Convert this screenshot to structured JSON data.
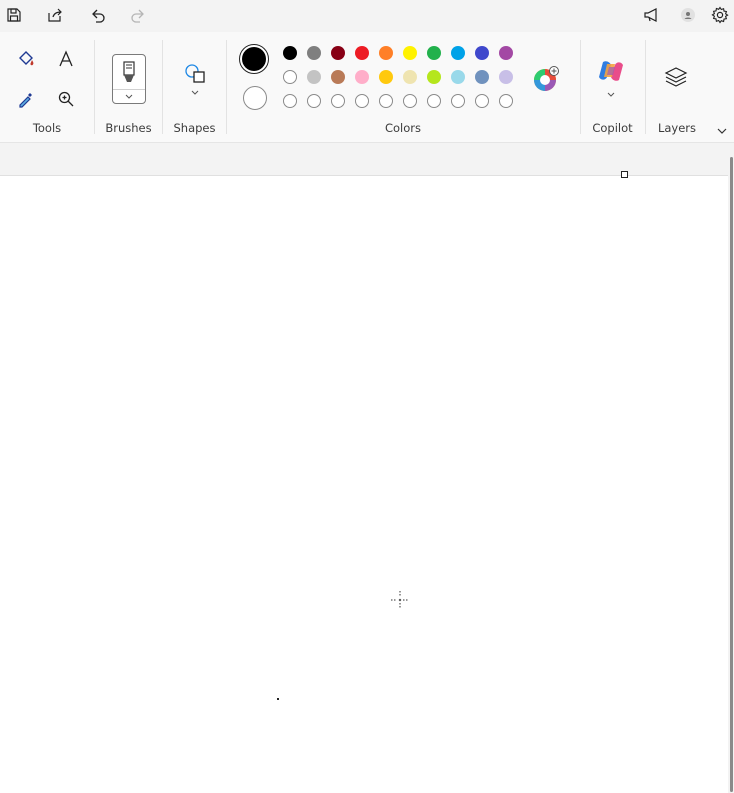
{
  "topbar": {
    "save": "save-icon",
    "share": "share-icon",
    "undo": "undo-icon",
    "redo": "redo-icon",
    "announce": "megaphone-icon",
    "account": "account-icon",
    "settings": "gear-icon"
  },
  "ribbon": {
    "tools_label": "Tools",
    "brushes_label": "Brushes",
    "shapes_label": "Shapes",
    "colors_label": "Colors",
    "copilot_label": "Copilot",
    "layers_label": "Layers",
    "primary_color": "#000000",
    "secondary_color": "#ffffff",
    "palette_row1": [
      "#000000",
      "#7f7f7f",
      "#880015",
      "#ed1c24",
      "#ff7f27",
      "#fff200",
      "#22b14c",
      "#00a2e8",
      "#3f48cc",
      "#a349a4"
    ],
    "palette_row2": [
      "#ffffff",
      "#c3c3c3",
      "#b97a57",
      "#ffaec9",
      "#ffc90e",
      "#efe4b0",
      "#b5e61d",
      "#99d9ea",
      "#7092be",
      "#c8bfe7"
    ],
    "palette_row3": [
      "",
      "",
      "",
      "",
      "",
      "",
      "",
      "",
      "",
      ""
    ]
  }
}
